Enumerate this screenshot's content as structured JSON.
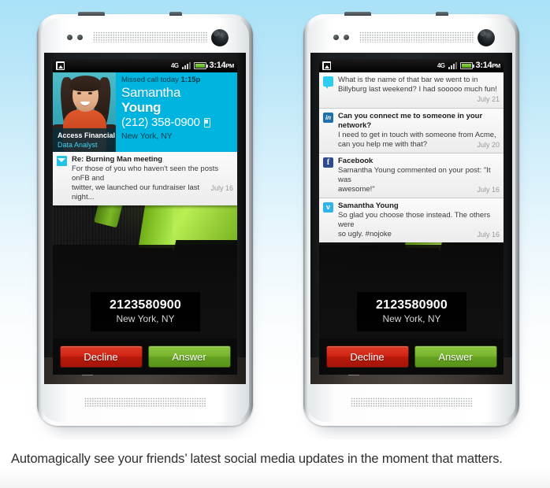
{
  "caption": "Automagically see your friends’ latest social media updates in the moment that matters.",
  "colors": {
    "accent_cyan": "#00b4e0",
    "decline_red": "#cf2414",
    "answer_green": "#76b42c",
    "role_teal": "#3fd2f0",
    "background_blue": "#a9e2f7"
  },
  "status_bar": {
    "notification_icon": "image-icon",
    "network": "4G",
    "signal_icon": "signal-bars-icon",
    "battery_icon": "battery-icon",
    "time": "3:14",
    "meridiem": "PM"
  },
  "caller_card": {
    "missed_label": "Missed call today",
    "missed_time": "1:15p",
    "first_name": "Samantha",
    "last_name": "Young",
    "phone": "(212) 358-0900",
    "phone_type_icon": "mobile-phone-icon",
    "location": "New York, NY",
    "photo_alt": "contact-photo",
    "company": "Access Financial",
    "role": "Data Analyst"
  },
  "left_notifications": [
    {
      "icon": "email-icon",
      "icon_class": "mail",
      "title": "Re: Burning Man meeting",
      "line1": "For those of you who haven't seen the posts onFB and",
      "line2": "twitter, we launched our fundraiser last night...",
      "date": "July 16"
    }
  ],
  "right_notifications": [
    {
      "icon": "sms-message-icon",
      "icon_class": "sms",
      "glyph": "",
      "title": "",
      "line1": "What is the name of that bar we went to in",
      "line2": "Billyburg last weekend? I had sooooo much fun!",
      "date": "July 21"
    },
    {
      "icon": "linkedin-icon",
      "icon_class": "linkedin",
      "glyph": "in",
      "title": "Can you connect me to someone in your network?",
      "line1": "I need to get in touch with someone from Acme,",
      "line2": "can you help me with that?",
      "date": "July 20"
    },
    {
      "icon": "facebook-icon",
      "icon_class": "facebook",
      "glyph": "f",
      "title": "Facebook",
      "line1": "Samantha Young commented on your post: \"It was",
      "line2": "awesome!\"",
      "date": "July 16"
    },
    {
      "icon": "twitter-icon",
      "icon_class": "twitter",
      "glyph": "ᴠ",
      "title": "Samantha Young",
      "line1": "So glad you choose those instead. The others were",
      "line2": "so ugly. #nojoke",
      "date": "July 16"
    }
  ],
  "call_screen": {
    "number": "2123580900",
    "location": "New York, NY",
    "mute_icon": "microphone-muted-icon",
    "speaker_icon": "speaker-icon",
    "decline_label": "Decline",
    "answer_label": "Answer"
  },
  "nav_bar": {
    "home_icon": "home-icon",
    "next_icon": "chevron-right-icon"
  },
  "device": {
    "earpiece_icon": "speaker-grille",
    "camera_icon": "front-camera-icon",
    "sensor_icon": "proximity-sensor-icon"
  }
}
